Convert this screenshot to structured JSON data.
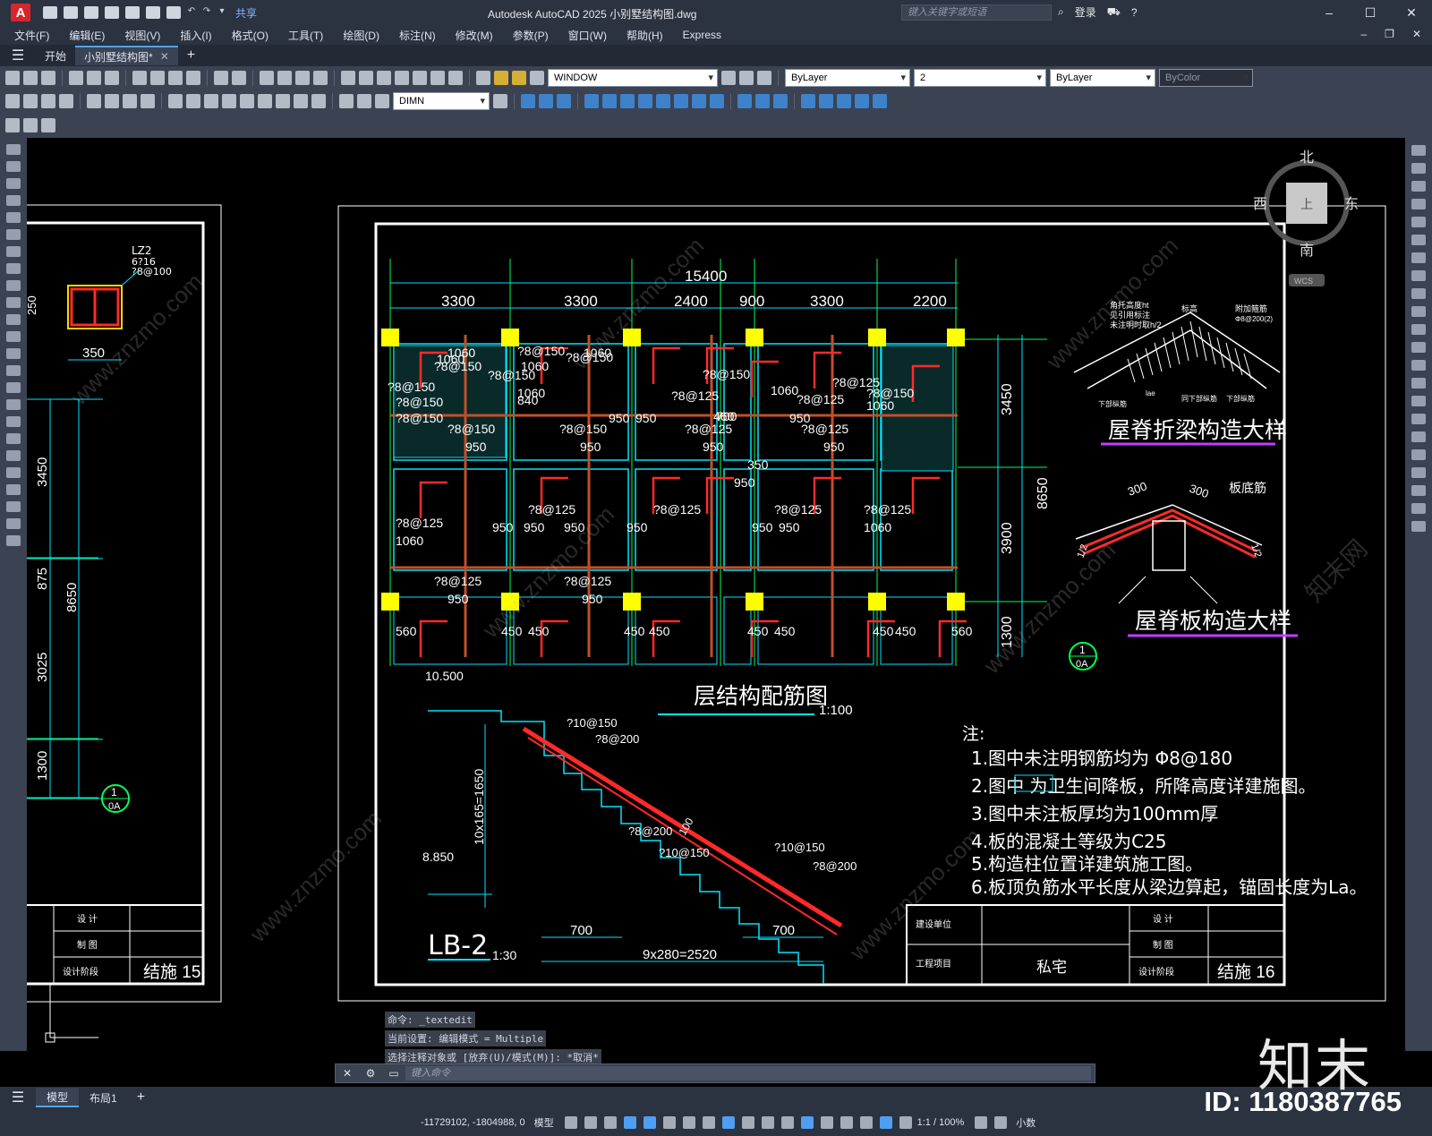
{
  "titlebar": {
    "app_logo": "A",
    "share": "共享",
    "title": "Autodesk AutoCAD 2025    小别墅结构图.dwg",
    "search_placeholder": "键入关键字或短语",
    "login": "登录"
  },
  "menu": {
    "items": [
      "文件(F)",
      "编辑(E)",
      "视图(V)",
      "插入(I)",
      "格式(O)",
      "工具(T)",
      "绘图(D)",
      "标注(N)",
      "修改(M)",
      "参数(P)",
      "窗口(W)",
      "帮助(H)",
      "Express"
    ]
  },
  "tabs": {
    "start": "开始",
    "document": "小别墅结构图*"
  },
  "toolbar": {
    "layer": "WINDOW",
    "color": "ByLayer",
    "linetype": "2",
    "lineweight": "ByLayer",
    "plotstyle": "ByColor",
    "dimstyle": "DIMN"
  },
  "viewcube": {
    "north": "北",
    "south": "南",
    "east": "东",
    "west": "西",
    "top": "上",
    "wcs": "WCS"
  },
  "drawing": {
    "left_sheet": {
      "column_label": "LZ2",
      "column_bars": "6?16",
      "column_stirrup": "?8@100",
      "column_height": "250",
      "column_width": "350",
      "dims": [
        "3450",
        "875",
        "8650",
        "3025",
        "1300"
      ],
      "axis_label": [
        "1",
        "0A"
      ],
      "title_rows": [
        "设 计",
        "制 图",
        "设计阶段"
      ],
      "sheet_no": "结施 15"
    },
    "plan": {
      "total_dim": "15400",
      "bay_dims": [
        "3300",
        "3300",
        "2400",
        "900",
        "3300",
        "2200"
      ],
      "right_dims": [
        "3450",
        "8650",
        "3900",
        "1300"
      ],
      "bar_labels": [
        "?8@150",
        "1060",
        "?8@150",
        "1060",
        "?8@150",
        "1060",
        "?8@150",
        "?8@150",
        "840",
        "?8@125",
        "460",
        "?8@150",
        "1060",
        "?8@125",
        "1060",
        "?8@150",
        "950",
        "950",
        "700",
        "950",
        "?8@125",
        "950",
        "950",
        "?8@125",
        "?8@125",
        "950",
        "950",
        "?8@125",
        "950",
        "950",
        "?8@125",
        "1060",
        "?8@125",
        "1060",
        "?8@150",
        "950",
        "?8@150",
        "950",
        "?8@125",
        "950",
        "?8@125",
        "950",
        "560",
        "450",
        "450",
        "450",
        "450",
        "450",
        "450",
        "450",
        "450",
        "560",
        "?8@150",
        "1060",
        "?8@150",
        "1060",
        "?8@125",
        "950",
        "?8@125",
        "950",
        "350",
        "950"
      ],
      "elevation": "10.500",
      "title": "层结构配筋图",
      "scale": "1:100",
      "axis_label": [
        "1",
        "0A"
      ]
    },
    "details": {
      "ridge_beam_title": "屋脊折梁构造大样",
      "ridge_beam_notes": [
        "角托高度ht",
        "见引用标注",
        "未注明时取h/2",
        "标高",
        "附加箍筋",
        "Φ8@200(2)",
        "lae",
        "下部纵筋",
        "同下部纵筋",
        "下部纵筋"
      ],
      "ridge_slab_title": "屋脊板构造大样",
      "ridge_slab_notes": [
        "300",
        "300",
        "板底筋",
        "1/2"
      ]
    },
    "stair": {
      "labels": [
        "?10@150",
        "?8@200",
        "?8@200",
        "?10@150",
        "?10@150",
        "?8@200",
        "100"
      ],
      "height": "10x165=1650",
      "elevation": "8.850",
      "dim_700_left": "700",
      "dim_700_right": "700",
      "run": "9x280=2520",
      "title": "LB-2",
      "scale": "1:30"
    },
    "notes": {
      "heading": "注:",
      "lines": [
        "1.图中未注明钢筋均为  Φ8@180",
        "2.图中      为卫生间降板，所降高度详建施图。",
        "3.图中未注板厚均为100mm厚",
        "4.板的混凝土等级为C25",
        "5.构造柱位置详建筑施工图。",
        "6.板顶负筋水平长度从梁边算起，锚固长度为La。"
      ]
    },
    "title_block": {
      "builder": "建设单位",
      "project": "工程项目",
      "project_name": "私宅",
      "rows": [
        "设 计",
        "制 图",
        "设计阶段"
      ],
      "sheet_no": "结施 16"
    },
    "watermark": "www.znzmo.com",
    "watermark_cn": "知末网"
  },
  "command": {
    "history": [
      "命令: _textedit",
      "当前设置: 编辑模式 = Multiple",
      "选择注释对象或 [放弃(U)/模式(M)]: *取消*"
    ],
    "placeholder": "键入命令"
  },
  "layouts": {
    "model": "模型",
    "layout1": "布局1"
  },
  "status": {
    "coords": "-11729102, -1804988, 0",
    "model": "模型",
    "scale": "1:1 / 100%",
    "units": "小数"
  },
  "watermark_corner": {
    "logo": "知末",
    "id": "ID: 1180387765"
  }
}
